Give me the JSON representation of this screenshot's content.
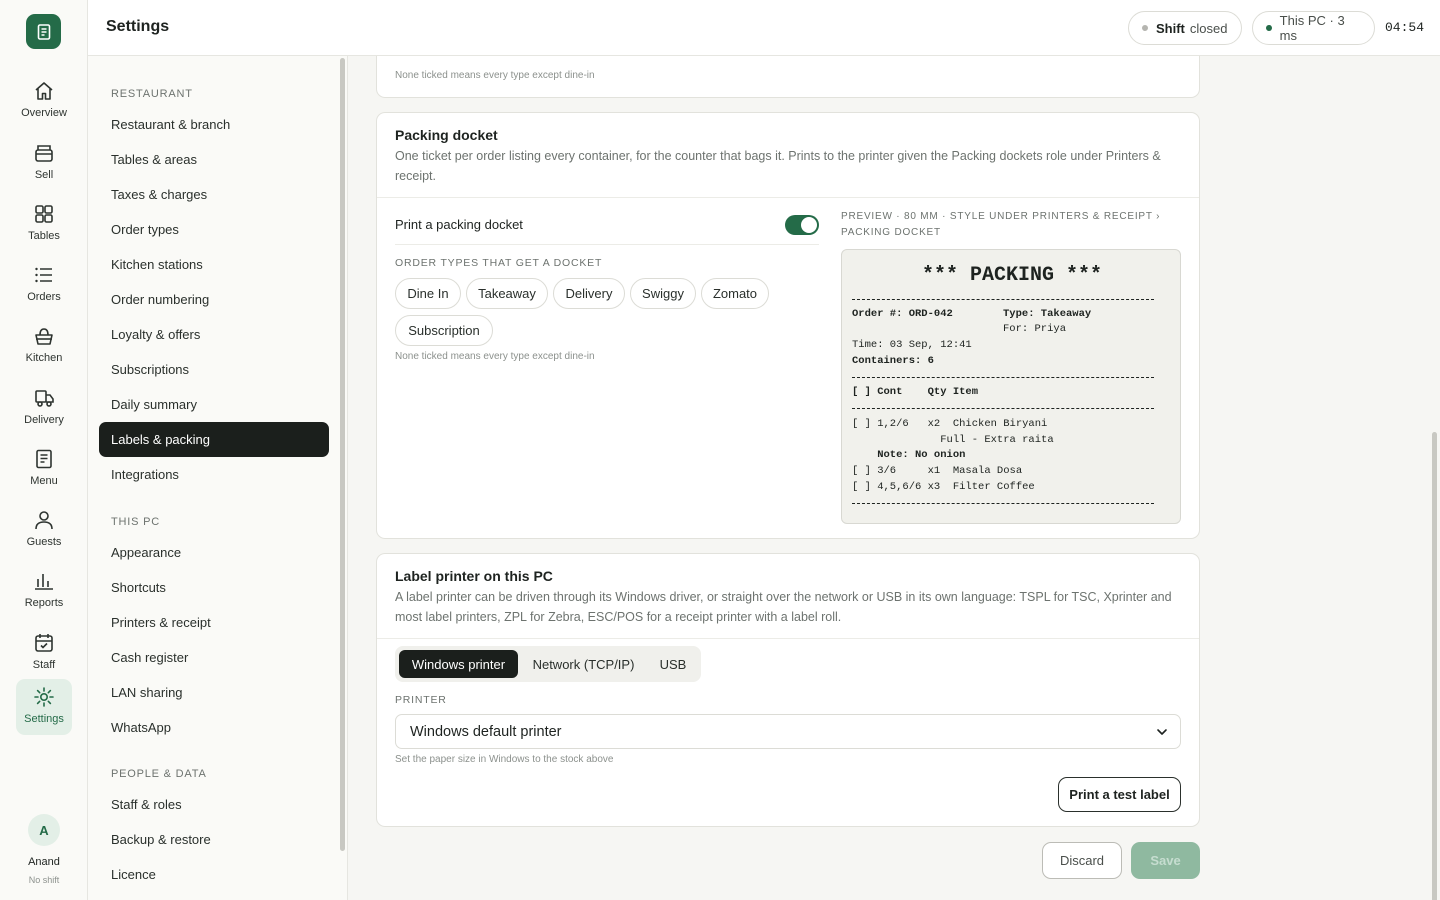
{
  "app": {
    "title": "Settings"
  },
  "status": {
    "shift_label": "Shift",
    "shift_state": "closed",
    "pc_label": "This PC · 3 ms",
    "clock": "04:54",
    "colors": {
      "shift_dot": "#b5b5b0",
      "pc_dot": "#246b48"
    }
  },
  "rail": {
    "items": [
      {
        "label": "Overview",
        "icon": "home-icon"
      },
      {
        "label": "Sell",
        "icon": "register-icon"
      },
      {
        "label": "Tables",
        "icon": "grid-icon"
      },
      {
        "label": "Orders",
        "icon": "list-icon"
      },
      {
        "label": "Kitchen",
        "icon": "basket-icon"
      },
      {
        "label": "Delivery",
        "icon": "truck-icon"
      },
      {
        "label": "Menu",
        "icon": "document-icon"
      },
      {
        "label": "Guests",
        "icon": "person-icon"
      },
      {
        "label": "Reports",
        "icon": "bar-chart-icon"
      },
      {
        "label": "Staff",
        "icon": "calendar-icon"
      },
      {
        "label": "Settings",
        "icon": "gear-icon",
        "active": true
      }
    ],
    "user": {
      "initial": "A",
      "name": "Anand",
      "shift": "No shift"
    }
  },
  "settings_nav": {
    "sections": [
      {
        "title": "RESTAURANT",
        "items": [
          "Restaurant & branch",
          "Tables & areas",
          "Taxes & charges",
          "Order types",
          "Kitchen stations",
          "Order numbering",
          "Loyalty & offers",
          "Subscriptions",
          "Daily summary",
          "Labels & packing",
          "Integrations"
        ]
      },
      {
        "title": "THIS PC",
        "items": [
          "Appearance",
          "Shortcuts",
          "Printers & receipt",
          "Cash register",
          "LAN sharing",
          "WhatsApp"
        ]
      },
      {
        "title": "PEOPLE & DATA",
        "items": [
          "Staff & roles",
          "Backup & restore",
          "Licence"
        ]
      }
    ],
    "active": "Labels & packing"
  },
  "prev_card": {
    "hint": "None ticked means every type except dine-in"
  },
  "packing": {
    "title": "Packing docket",
    "description": "One ticket per order listing every container, for the counter that bags it. Prints to the printer given the Packing dockets role under Printers & receipt.",
    "toggle_label": "Print a packing docket",
    "toggle_on": true,
    "order_types_heading": "ORDER TYPES THAT GET A DOCKET",
    "order_types": [
      "Dine In",
      "Takeaway",
      "Delivery",
      "Swiggy",
      "Zomato",
      "Subscription"
    ],
    "hint": "None ticked means every type except dine-in",
    "preview_caption_1": "PREVIEW · 80 MM · STYLE UNDER PRINTERS & RECEIPT ›",
    "preview_caption_2": "PACKING DOCKET",
    "receipt": {
      "header": "*** PACKING ***",
      "order_no": "Order #: ORD-042",
      "type": "Type: Takeaway",
      "for": "For: Priya",
      "time": "Time: 03 Sep, 12:41",
      "containers": "Containers: 6",
      "columns": "[ ] Cont    Qty Item",
      "lines": [
        "[ ] 1,2/6   x2  Chicken Biryani",
        "              Full - Extra raita",
        "    Note: No onion",
        "[ ] 3/6     x1  Masala Dosa",
        "[ ] 4,5,6/6 x3  Filter Coffee"
      ]
    }
  },
  "label_printer": {
    "title": "Label printer on this PC",
    "description": "A label printer can be driven through its Windows driver, or straight over the network or USB in its own language: TSPL for TSC, Xprinter and most label printers, ZPL for Zebra, ESC/POS for a receipt printer with a label roll.",
    "modes": [
      "Windows printer",
      "Network (TCP/IP)",
      "USB"
    ],
    "active_mode": "Windows printer",
    "printer_heading": "PRINTER",
    "printer_value": "Windows default printer",
    "printer_hint": "Set the paper size in Windows to the stock above",
    "test_button": "Print a test label"
  },
  "actions": {
    "discard": "Discard",
    "save": "Save"
  }
}
